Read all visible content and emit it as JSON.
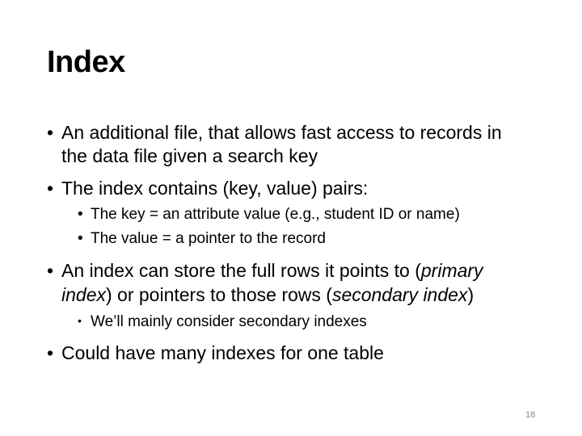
{
  "slide": {
    "title": "Index",
    "page_number": "18",
    "bullets": [
      {
        "line1": "An additional file, that allows fast access to records in",
        "line2": "the data file given a search key"
      },
      {
        "text": "The  index  contains  (key,  value)  pairs:"
      },
      {
        "text": "The  key  =  an  attribute  value  (e.g.,  student  ID  or  name)"
      },
      {
        "text": "The  value  =  a  pointer  to  the  record"
      },
      {
        "line1_a": "An index can store the full rows it points to (",
        "line1_em": "primary",
        "line2_em": "index",
        "line2_b": ") or pointers to those rows (",
        "line2_em2": "secondary index",
        "line2_c": ")"
      },
      {
        "text": "We’ll mainly consider secondary indexes"
      },
      {
        "text": "Could  have  many  indexes  for  one  table"
      }
    ],
    "bullet_glyph": "•"
  }
}
